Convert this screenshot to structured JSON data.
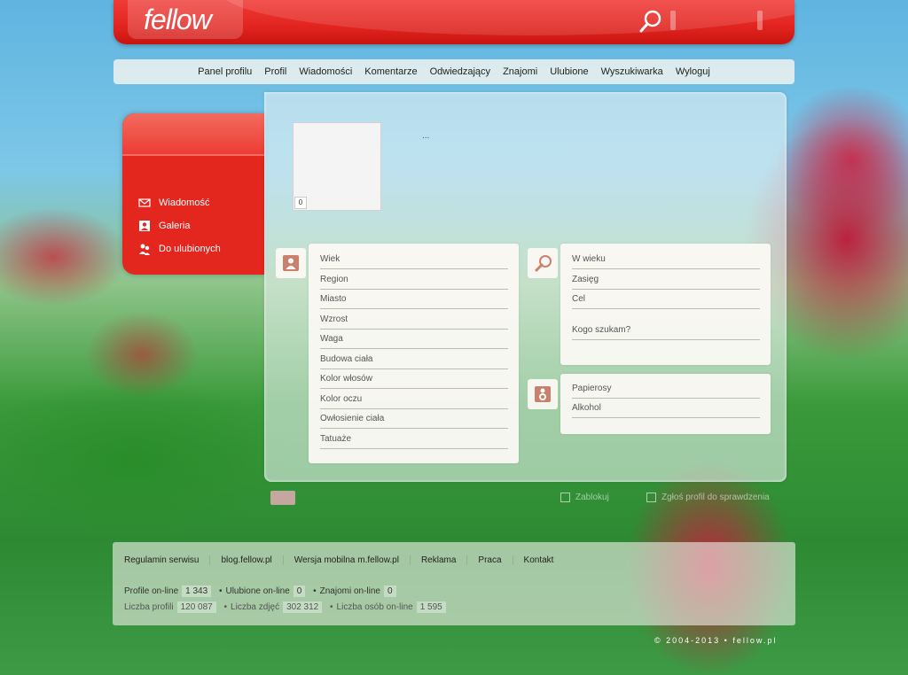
{
  "header": {
    "logo": "fellow",
    "search_icon": "search-icon"
  },
  "nav": {
    "items": [
      "Panel profilu",
      "Profil",
      "Wiadomości",
      "Komentarze",
      "Odwiedzający",
      "Znajomi",
      "Ulubione",
      "Wyszukiwarka",
      "Wyloguj"
    ]
  },
  "sidebar": {
    "items": [
      {
        "label": "Wiadomość",
        "icon": "envelope-icon"
      },
      {
        "label": "Galeria",
        "icon": "image-icon"
      },
      {
        "label": "Do ulubionych",
        "icon": "people-icon"
      }
    ]
  },
  "profile": {
    "photo_count": "0",
    "nick": "..."
  },
  "about": {
    "icon": "person-icon",
    "fields": [
      "Wiek",
      "Region",
      "Miasto",
      "Wzrost",
      "Waga",
      "Budowa ciała",
      "Kolor włosów",
      "Kolor oczu",
      "Owłosienie ciała",
      "Tatuaże"
    ]
  },
  "looking_for": {
    "icon": "magnifier-icon",
    "fields": [
      "W wieku",
      "Zasięg",
      "Cel"
    ],
    "who_label": "Kogo szukam?"
  },
  "habits": {
    "icon": "user-badge-icon",
    "fields": [
      "Papierosy",
      "Alkohol"
    ]
  },
  "options": {
    "option1": "Zablokuj",
    "option2": "Zgłoś profil do sprawdzenia"
  },
  "footer": {
    "links": [
      "Regulamin serwisu",
      "blog.fellow.pl",
      "Wersja mobilna m.fellow.pl",
      "Reklama",
      "Praca",
      "Kontakt"
    ],
    "stats1": [
      {
        "label": "Profile on-line",
        "value": "1 343"
      },
      {
        "label": "Ulubione on-line",
        "value": "0"
      },
      {
        "label": "Znajomi on-line",
        "value": "0"
      }
    ],
    "stats2": [
      {
        "label": "Liczba profili",
        "value": "120 087"
      },
      {
        "label": "Liczba zdjęć",
        "value": "302 312"
      },
      {
        "label": "Liczba osób on-line",
        "value": "1 595"
      }
    ],
    "copyright": "© 2004-2013 • fellow.pl"
  }
}
